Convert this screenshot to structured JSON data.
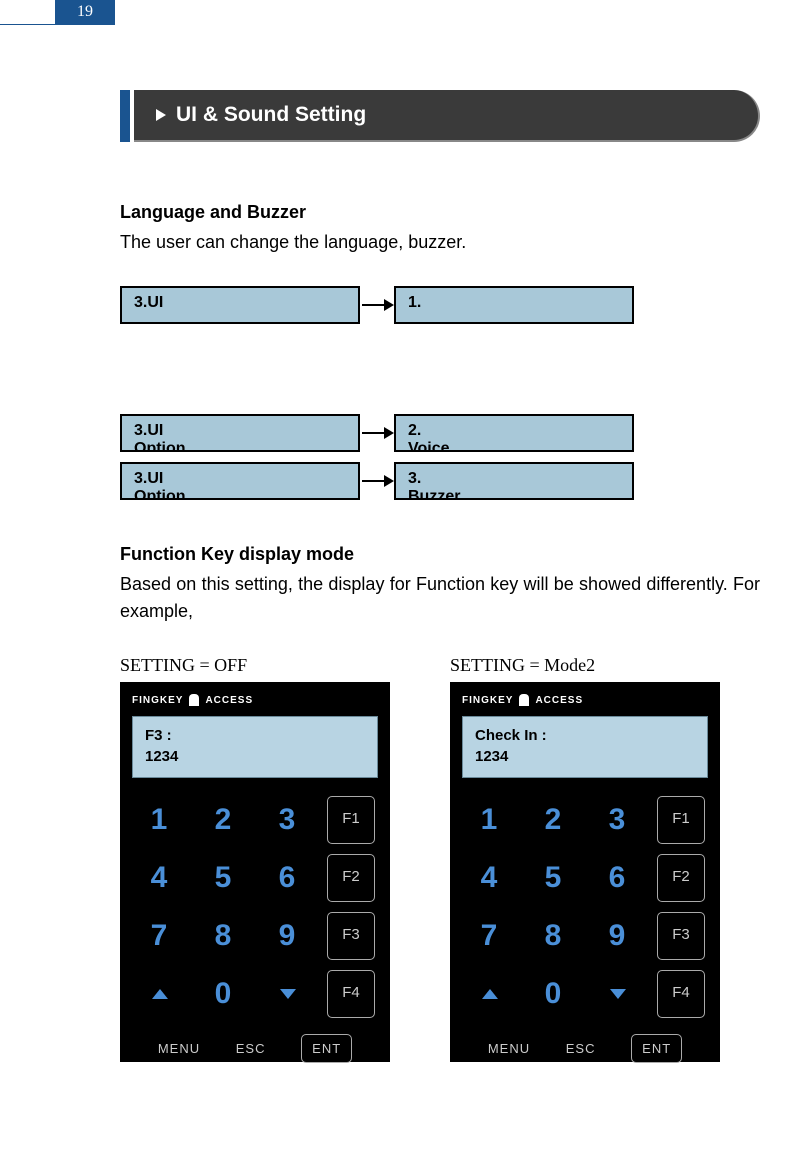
{
  "page_number": "19",
  "banner_title": "UI & Sound Setting",
  "section1_heading": "Language and Buzzer",
  "section1_text": "The user can change the language, buzzer.",
  "flow1": {
    "left": "3.UI",
    "right": "1."
  },
  "flow2": {
    "left_line1": "3.UI",
    "left_line2": "Option",
    "right_line1": "2.",
    "right_line2": "Voice"
  },
  "flow3": {
    "left_line1": "3.UI",
    "left_line2": "Option",
    "right_line1": "3.",
    "right_line2": "Buzzer"
  },
  "section2_heading": "Function Key display mode",
  "section2_text": "Based on this setting, the display for Function key will be showed differently. For example,",
  "device_logo_left": "FINGKEY",
  "device_logo_right": "ACCESS",
  "keys": {
    "k1": "1",
    "k2": "2",
    "k3": "3",
    "k4": "4",
    "k5": "5",
    "k6": "6",
    "k7": "7",
    "k8": "8",
    "k9": "9",
    "k0": "0",
    "f1": "F1",
    "f2": "F2",
    "f3": "F3",
    "f4": "F4",
    "menu": "MENU",
    "esc": "ESC",
    "ent": "ENT"
  },
  "example_off": {
    "label": "SETTING = OFF",
    "display_line1": "F3 :",
    "display_line2": "1234"
  },
  "example_mode2": {
    "label": "SETTING = Mode2",
    "display_line1": "Check In :",
    "display_line2": "1234"
  }
}
